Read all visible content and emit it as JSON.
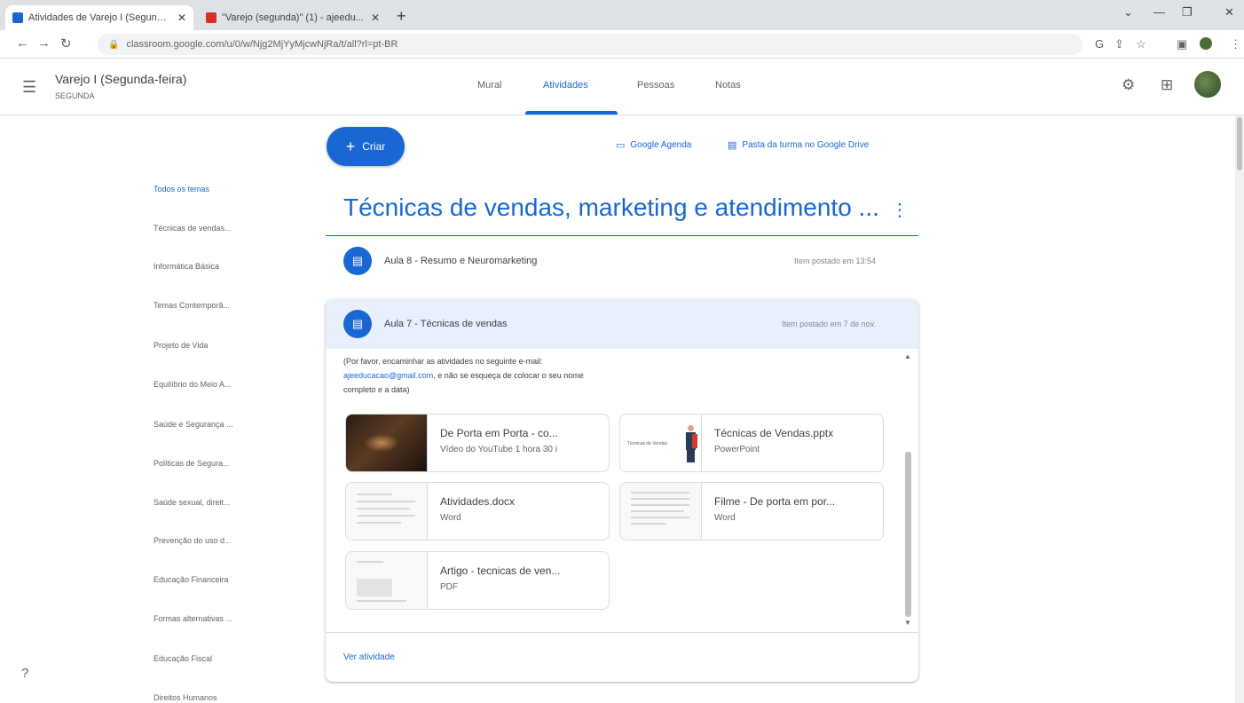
{
  "browser": {
    "tabs": [
      {
        "title": "Atividades de Varejo I (Segunda-",
        "active": true
      },
      {
        "title": "\"Varejo (segunda)\" (1) - ajeedu...",
        "active": false
      }
    ],
    "url": "classroom.google.com/u/0/w/Njg2MjYyMjcwNjRa/t/all?rl=pt-BR"
  },
  "header": {
    "class_name": "Varejo I (Segunda-feira)",
    "class_section": "SEGUNDA",
    "tabs": [
      "Mural",
      "Atividades",
      "Pessoas",
      "Notas"
    ],
    "active_tab": "Atividades"
  },
  "actions": {
    "create_label": "Criar",
    "calendar_label": "Google Agenda",
    "drive_label": "Pasta da turma no Google Drive"
  },
  "sidebar": {
    "items": [
      "Todos os temas",
      "Técnicas de vendas...",
      "Informática Básica",
      "Temas Contemporâ...",
      "Projeto de Vida",
      "Equilíbrio do Meio A...",
      "Saúde e Segurança ...",
      "Políticas de Segura...",
      "Saúde sexual, direit...",
      "Prevenção do uso d...",
      "Educação Financeira",
      "Formas alternativas ...",
      "Educação Fiscal",
      "Direitos Humanos"
    ]
  },
  "topic": {
    "title": "Técnicas de vendas, marketing e atendimento ..."
  },
  "assignments": [
    {
      "title": "Aula 8 - Resumo e Neuromarketing",
      "date": "Item postado em 13:54"
    },
    {
      "title": "Aula 7 - Técnicas de vendas",
      "date": "Item postado em 7 de nov."
    }
  ],
  "expanded": {
    "description_1": "(Por favor, encaminhar as atividades no seguinte e-mail:",
    "email": "ajeeducacao@gmail.com",
    "description_2": ", e não se esqueça de colocar o seu nome",
    "description_3": "completo e a data)",
    "attachments": [
      {
        "name": "De Porta em Porta - co...",
        "type": "Vídeo do YouTube  1 hora 30 i"
      },
      {
        "name": "Técnicas de Vendas.pptx",
        "type": "PowerPoint"
      },
      {
        "name": "Atividades.docx",
        "type": "Word"
      },
      {
        "name": "Filme - De porta em por...",
        "type": "Word"
      },
      {
        "name": "Artigo - tecnicas de ven...",
        "type": "PDF"
      }
    ],
    "ppt_thumb_label": "Técnicas de Vendas",
    "view_label": "Ver atividade"
  },
  "colors": {
    "accent": "#1967d2",
    "expanded_header": "#e8f0fe"
  }
}
